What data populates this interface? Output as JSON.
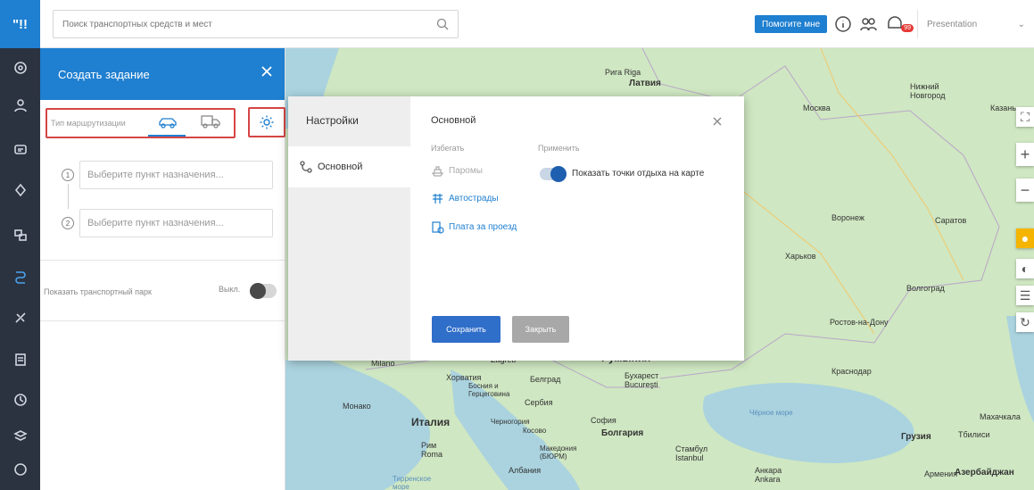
{
  "topbar": {
    "search_placeholder": "Поиск транспортных средств и мест",
    "help_label": "Помогите мне",
    "notification_count": "99",
    "account_label": "Presentation"
  },
  "rail": {
    "logo": "\"!!",
    "icons": [
      "dashboard-icon",
      "user-icon",
      "chat-icon",
      "location-icon",
      "objects-icon",
      "routes-icon",
      "tools-icon",
      "documents-icon",
      "history-icon",
      "layers-icon",
      "more-icon"
    ]
  },
  "task_panel": {
    "title": "Создать задание",
    "routing_type_label": "Тип маршрутизации",
    "stops": [
      {
        "num": "1",
        "placeholder": "Выберите пункт назначения..."
      },
      {
        "num": "2",
        "placeholder": "Выберите пункт назначения..."
      }
    ],
    "fleet_label": "Показать транспортный парк",
    "fleet_state": "Выкл."
  },
  "settings_modal": {
    "side_title": "Настройки",
    "side_item": "Основной",
    "title": "Основной",
    "avoid_header": "Избегать",
    "apply_header": "Применить",
    "avoid_options": [
      "Паромы",
      "Автострады",
      "Плата за проезд"
    ],
    "rest_points_label": "Показать точки отдыха на карте",
    "save_label": "Сохранить",
    "close_label": "Закрыть"
  },
  "map_labels": {
    "riga": "Рига\nRiga",
    "latvia": "Латвия",
    "moscow": "Москва",
    "nizhny": "Нижний Новгород",
    "kazan": "Казань",
    "voronezh": "Воронеж",
    "saratov": "Саратов",
    "kharkov": "Харьков",
    "volgograd": "Волгоград",
    "rostov": "Ростов-на-Дону",
    "krasnodar": "Краснодар",
    "romania": "Румыния",
    "bucharest": "Бухарест\nBucureşti",
    "zagreb": "Zagreb",
    "croatia": "Хорватия",
    "belgrade": "Белград",
    "bosnia": "Босния и Герцеговина",
    "serbia": "Сербия",
    "italy": "Италия",
    "monaco": "Монако",
    "milano": "Milano",
    "montenegro": "Черногория",
    "kosovo": "Косово",
    "sofia": "София",
    "bulgaria": "Болгария",
    "rome": "Рим\nRoma",
    "macedonia": "Македония\n(БЮРМ)",
    "albania": "Албания",
    "istanbul": "Стамбул\nIstanbul",
    "ankara": "Анкара\nAnkara",
    "black_sea": "Чёрное море",
    "makhachkala": "Махачкала",
    "georgia": "Грузия",
    "tbilisi": "Тбилиси",
    "armenia": "Армения",
    "azerbaijan": "Азербайджан",
    "tyrrhenian": "Тирренское море"
  }
}
